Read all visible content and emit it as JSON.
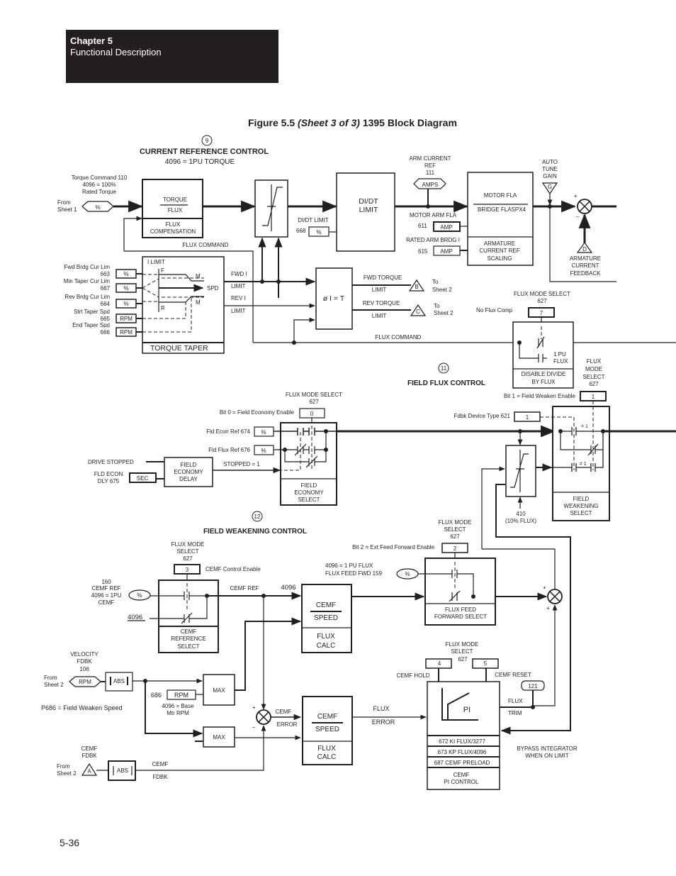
{
  "header": {
    "chapter": "Chapter 5",
    "subtitle": "Functional Description"
  },
  "figure": {
    "prefix": "Figure 5.5 ",
    "sheet": "(Sheet 3 of 3)",
    "suffix": " 1395 Block Diagram"
  },
  "page_number": "5-36",
  "sections": {
    "current_ref": {
      "number": "9",
      "title": "CURRENT REFERENCE CONTROL",
      "note": "4096 = 1PU TORQUE"
    },
    "field_flux": {
      "number": "11",
      "title": "FIELD FLUX CONTROL"
    },
    "field_weak": {
      "number": "12",
      "title": "FIELD WEAKENING CONTROL"
    }
  },
  "current_ref": {
    "torque_cmd": [
      "Torque Command 110",
      "4096 = 100%",
      "Rated Torque"
    ],
    "from_sheet1": [
      "From",
      "Sheet 1"
    ],
    "pct": "%",
    "torque_block": {
      "top": "TORQUE",
      "bottom": "FLUX",
      "label": [
        "FLUX",
        "COMPENSATION"
      ]
    },
    "flux_command": "FLUX COMMAND",
    "didt_limit_label": "DI/DT LIMIT",
    "didt_param": "668",
    "didt_block": [
      "DI/DT",
      "LIMIT"
    ],
    "arm_current_ref": [
      "ARM CURRENT",
      "REF",
      "111"
    ],
    "amps": "AMPS",
    "motor_arm_fla": "MOTOR ARM FLA",
    "p611": "611",
    "amp": "AMP",
    "rated_arm": "RATED ARM BRDG I",
    "p615": "615",
    "scaling_block": {
      "top": "MOTOR FLA",
      "bottom": "BRIDGE FLASPX4",
      "label": [
        "ARMATURE",
        "CURRENT REF",
        "SCALING"
      ]
    },
    "auto_tune": [
      "AUTO",
      "TUNE",
      "GAIN"
    ],
    "g": "G",
    "d": "D",
    "arm_fdbk": [
      "ARMATURE",
      "CURRENT",
      "FEEDBACK"
    ],
    "plus": "+",
    "minus": "–"
  },
  "torque_taper": {
    "inputs": [
      {
        "name": "Fwd Brdg Cur Lim",
        "param": "663",
        "unit": "%"
      },
      {
        "name": "Min Taper Cur Lim",
        "param": "667",
        "unit": "%"
      },
      {
        "name": "Rev Brdg Cur Lim",
        "param": "664",
        "unit": "%"
      },
      {
        "name": "Strt Taper Spd",
        "param": "665",
        "unit": "RPM"
      },
      {
        "name": "End Taper Spd",
        "param": "666",
        "unit": "RPM"
      }
    ],
    "i_limit": "I LIMIT",
    "f": "F",
    "r": "R",
    "m": "M",
    "spd": "SPD",
    "label": "TORQUE TAPER",
    "fwd_i": "FWD I",
    "limit": "LIMIT",
    "rev_i": "REV I",
    "phi_block": "ø I = T",
    "fwd_torque": "FWD TORQUE",
    "rev_torque": "REV TORQUE",
    "b": "B",
    "c": "C",
    "to_sheet2": [
      "To",
      "Sheet 2"
    ],
    "flux_command": "FLUX COMMAND"
  },
  "disable_divide": {
    "select_label": [
      "FLUX MODE SELECT",
      "627"
    ],
    "no_flux_comp": "No Flux Comp",
    "bit": "7",
    "pu_flux": [
      "1 PU",
      "FLUX"
    ],
    "label": [
      "DISABLE DIVIDE",
      "BY FLUX"
    ]
  },
  "field_economy": {
    "select_label": [
      "FLUX MODE SELECT",
      "627"
    ],
    "bit_text": "Bit 0 = Field Economy Enable",
    "bit": "0",
    "econ_ref": "Fld Econ Ref 674",
    "flux_ref": "Fld Flux Ref 676",
    "pct": "%",
    "drive_stopped": "DRIVE STOPPED",
    "fld_econ_dly": [
      "FLD ECON",
      "DLY 675"
    ],
    "sec": "SEC",
    "delay_block": [
      "FIELD",
      "ECONOMY",
      "DELAY"
    ],
    "stopped": "STOPPED = 1",
    "label": [
      "FIELD",
      "ECONOMY",
      "SELECT"
    ]
  },
  "field_weakening_select": {
    "select_label": [
      "FLUX",
      "MODE",
      "SELECT",
      "627"
    ],
    "bit_text": "Bit 1 = Field Weaken Enable",
    "bit": "1",
    "fdbk_device": "Fdbk Device Type 621",
    "fdbk_value": "1",
    "eq1": "= 1",
    "ne1": "≠ 1",
    "limit_note": [
      "410",
      "(10% FLUX)"
    ],
    "label": [
      "FIELD",
      "WEAKENING",
      "SELECT"
    ]
  },
  "cemf_ref": {
    "select_label": [
      "FLUX MODE",
      "SELECT",
      "627"
    ],
    "bit": "3",
    "enable": "CEMF Control Enable",
    "ref_lines": [
      "160",
      "CEMF REF",
      "4096 = 1PU",
      "CEMF"
    ],
    "pct": "%",
    "const": "4096",
    "cemf_ref_label": "CEMF REF",
    "c4096": "4096",
    "label": [
      "CEMF",
      "REFERENCE",
      "SELECT"
    ]
  },
  "flux_calc": {
    "top": "CEMF",
    "bottom": "SPEED",
    "label": [
      "FLUX",
      "CALC"
    ]
  },
  "feed_forward": {
    "select_label": [
      "FLUX MODE",
      "SELECT",
      "627"
    ],
    "bit_text": "Bit 2 = Ext Feed Forward Enable",
    "bit": "2",
    "ff_lines": [
      "4096 = 1 PU FLUX",
      "FLUX FEED FWD 159"
    ],
    "pct": "%",
    "label": [
      "FLUX FEED",
      "FORWARD SELECT"
    ]
  },
  "velocity": {
    "lines": [
      "VELOCITY",
      "FDBK",
      "106"
    ],
    "from": [
      "From",
      "Sheet 2"
    ],
    "rpm": "RPM",
    "abs": "ABS",
    "max": "MAX",
    "p686": "686",
    "base": [
      "4096 = Base",
      "Mtr RPM"
    ],
    "note": "P686 = Field Weaken Speed",
    "cemf_fdbk": [
      "CEMF",
      "FDBK"
    ],
    "a": "A",
    "cemf": "CEMF",
    "fdbk": "FDBK",
    "cemf_error": [
      "CEMF",
      "ERROR"
    ]
  },
  "pi_control": {
    "select_label": [
      "FLUX MODE",
      "SELECT",
      "627"
    ],
    "bit4": "4",
    "bit5": "5",
    "hold": "CEMF HOLD",
    "reset": "CEMF RESET",
    "p121": "121",
    "pi": "PI",
    "flux_error": [
      "FLUX",
      "ERROR"
    ],
    "flux_trim": [
      "FLUX",
      "TRIM"
    ],
    "params": [
      "672 KI FLUX/3277",
      "673 KP FLUX/4096",
      "687 CEMF PRELOAD"
    ],
    "label": [
      "CEMF",
      "PI CONTROL"
    ],
    "bypass": [
      "BYPASS INTEGRATOR",
      "WHEN ON LIMIT"
    ]
  }
}
